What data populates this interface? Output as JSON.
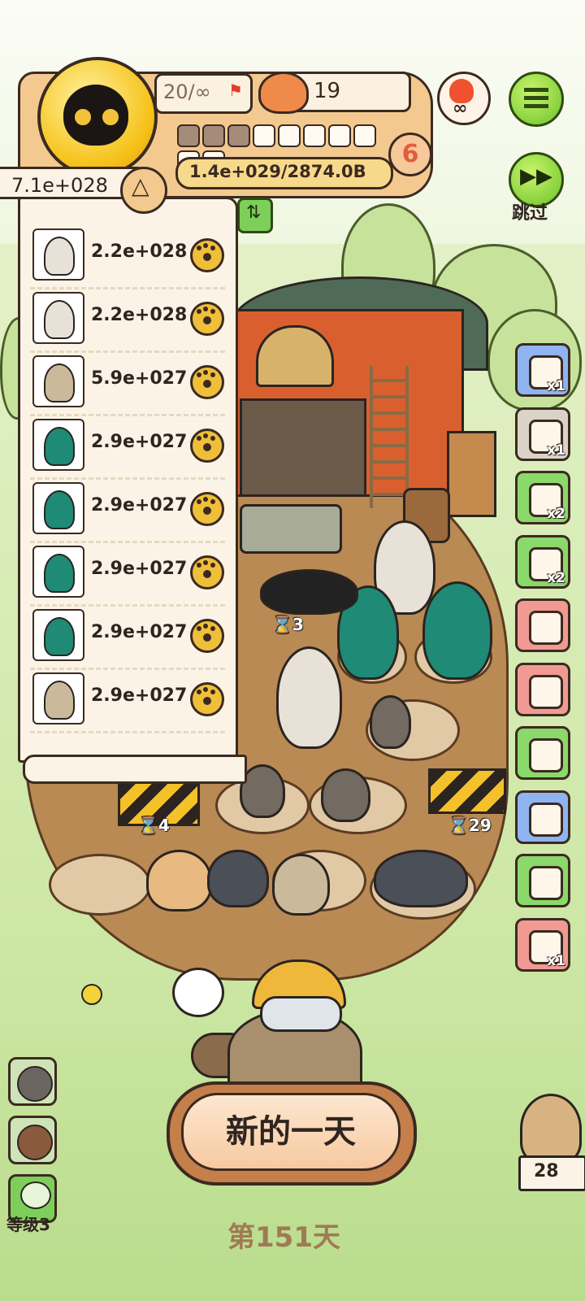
{
  "hud": {
    "capacity": "20/∞",
    "food_count": "19",
    "level": "6",
    "progress_filled": 3,
    "progress_total": 10,
    "exp_text": "1.4e+029/2874.0B"
  },
  "skip": {
    "label": "跳过"
  },
  "income_list": {
    "total": "7.1e+028",
    "rows": [
      {
        "animal": "alpaca",
        "value": "2.2e+028"
      },
      {
        "animal": "alpaca",
        "value": "2.2e+028"
      },
      {
        "animal": "hedgehog",
        "value": "5.9e+027"
      },
      {
        "animal": "peacock",
        "value": "2.9e+027"
      },
      {
        "animal": "peacock",
        "value": "2.9e+027"
      },
      {
        "animal": "peacock",
        "value": "2.9e+027"
      },
      {
        "animal": "peacock",
        "value": "2.9e+027"
      },
      {
        "animal": "hedgehog",
        "value": "2.9e+027"
      }
    ]
  },
  "field_timers": {
    "t1": "3",
    "t2": "4",
    "t3": "29"
  },
  "side_items": [
    {
      "icon": "vr-goggles-icon",
      "badge": "x1",
      "color": "#8fb4f0"
    },
    {
      "icon": "biscuit-icon",
      "badge": "x1",
      "color": "#d9d4c7"
    },
    {
      "icon": "ticket-icon",
      "badge": "x2",
      "color": "#8bd86b"
    },
    {
      "icon": "worker-group-icon",
      "badge": "x2",
      "color": "#8bd86b"
    },
    {
      "icon": "feather-icon",
      "badge": "",
      "color": "#f19a94"
    },
    {
      "icon": "heart-pet-icon",
      "badge": "",
      "color": "#f19a94"
    },
    {
      "icon": "card-icon",
      "badge": "",
      "color": "#8bd86b"
    },
    {
      "icon": "discount-coupon-icon",
      "badge": "",
      "color": "#8fb4f0"
    },
    {
      "icon": "voucher-icon",
      "badge": "",
      "color": "#8bd86b"
    },
    {
      "icon": "scroll-icon",
      "badge": "x1",
      "color": "#f19a94"
    }
  ],
  "bottom": {
    "new_day": "新的一天",
    "day_label": "第151天",
    "player_level": "等级3",
    "hamster_count": "28"
  }
}
